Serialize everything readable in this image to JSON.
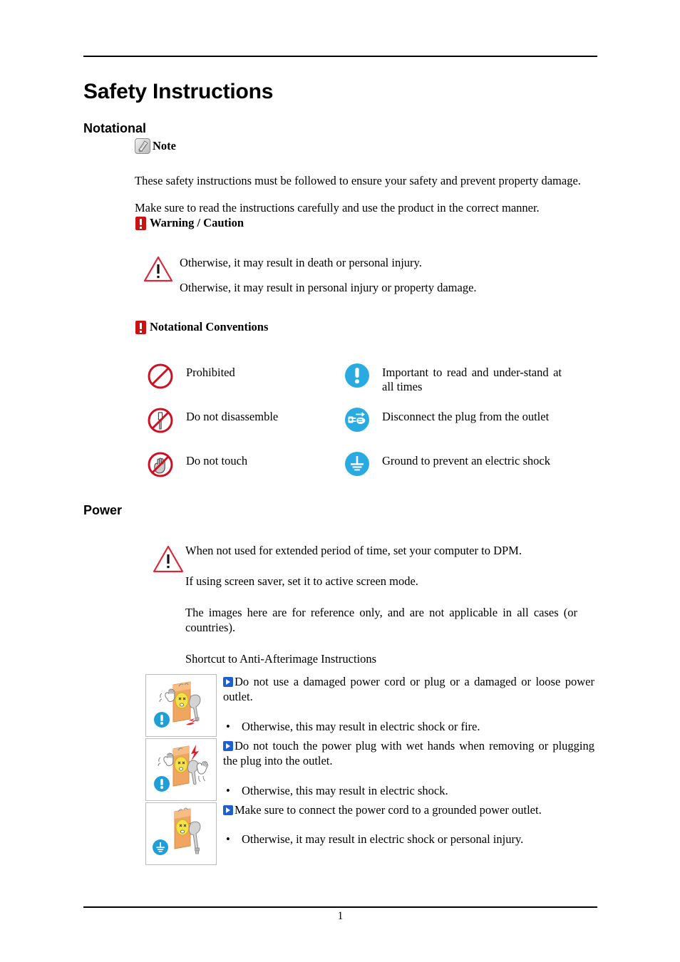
{
  "document": {
    "title": "Safety Instructions",
    "page_number": "1"
  },
  "sections": {
    "notational": {
      "heading": "Notational",
      "note_label": "Note",
      "note_icon": "note-pen-icon",
      "paragraphs": [
        "These safety instructions must be followed to ensure your safety and prevent property damage.",
        "Make sure to read the instructions carefully and use the product in the correct manner."
      ],
      "warning_caution_label": "Warning / Caution",
      "warning_icon": "red-exclamation-icon",
      "caution_icon": "caution-triangle-icon",
      "caution_lines": [
        "Otherwise, it may result in death or personal injury.",
        "Otherwise, it may result in personal injury or property damage."
      ],
      "conventions_label": "Notational Conventions",
      "conventions": [
        {
          "icon": "prohibited-icon",
          "label": "Prohibited"
        },
        {
          "icon": "important-read-icon",
          "label": "Important to read and under-stand at all times"
        },
        {
          "icon": "do-not-disassemble-icon",
          "label": "Do not disassemble"
        },
        {
          "icon": "disconnect-plug-icon",
          "label": "Disconnect the plug from the outlet"
        },
        {
          "icon": "do-not-touch-icon",
          "label": "Do not touch"
        },
        {
          "icon": "ground-icon",
          "label": "Ground to prevent an electric shock"
        }
      ]
    },
    "power": {
      "heading": "Power",
      "caution_icon": "caution-triangle-icon",
      "paragraphs": [
        "When not used for extended period of time, set your computer to DPM.",
        "If using screen saver, set it to active screen mode.",
        "The images here are for reference only, and are not applicable in all cases (or countries).",
        "Shortcut to Anti-Afterimage Instructions"
      ],
      "warnings": [
        {
          "image": "damaged-power-cord-illustration",
          "badge": "important-read-icon",
          "title": "Do not use a damaged power cord or plug or a damaged or loose power outlet.",
          "bullet_marker": "•",
          "bullet": "Otherwise, this may result in electric shock or fire."
        },
        {
          "image": "wet-hands-plug-illustration",
          "badge": "important-read-icon",
          "title": "Do not touch the power plug with wet hands when removing or plugging the plug into the outlet.",
          "bullet_marker": "•",
          "bullet": "Otherwise, this may result in electric shock."
        },
        {
          "image": "grounded-outlet-illustration",
          "badge": "ground-icon",
          "title": "Make sure to connect the power cord to a grounded power outlet.",
          "bullet_marker": "•",
          "bullet": "Otherwise, it may result in electric shock or personal injury."
        }
      ]
    }
  },
  "colors": {
    "prohibition_red": "#cc1122",
    "warning_red": "#cc1111",
    "icon_blue": "#29abe2",
    "arrow_blue": "#1f5fd0",
    "outlet_orange": "#f0a660",
    "face_yellow": "#f5e04a"
  }
}
